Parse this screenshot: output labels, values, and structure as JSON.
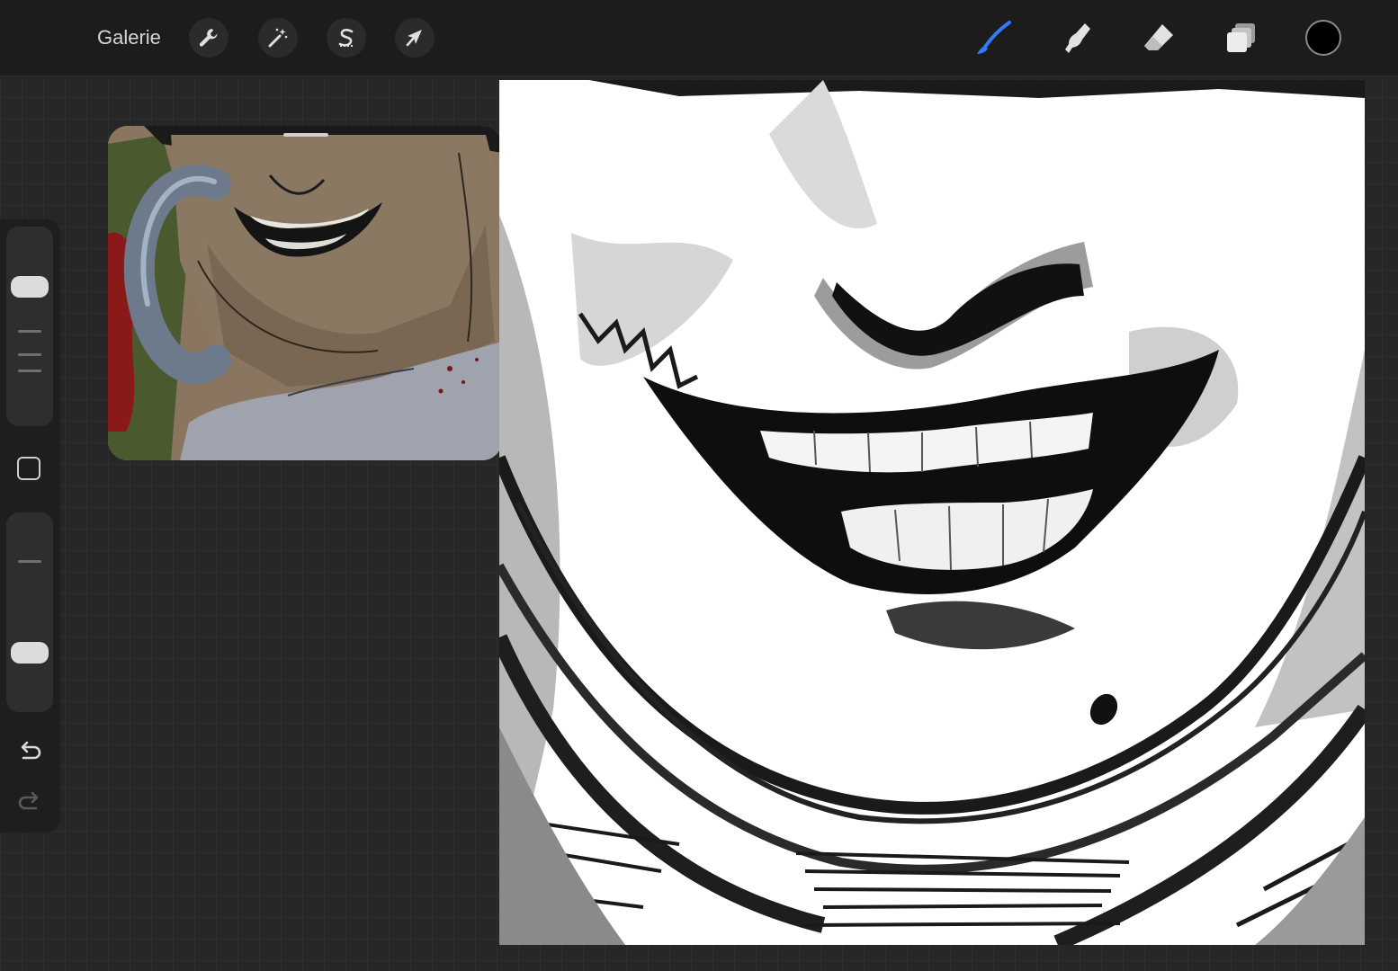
{
  "toolbar": {
    "gallery_label": "Galerie",
    "left_tools": [
      {
        "icon": "wrench-icon",
        "name": "actions"
      },
      {
        "icon": "magic-wand-icon",
        "name": "adjustments"
      },
      {
        "icon": "selection-s-icon",
        "name": "selection"
      },
      {
        "icon": "arrow-cursor-icon",
        "name": "transform"
      }
    ],
    "right_tools": [
      {
        "icon": "brush-icon",
        "name": "paint",
        "active": true
      },
      {
        "icon": "smudge-icon",
        "name": "smudge",
        "active": false
      },
      {
        "icon": "eraser-icon",
        "name": "eraser",
        "active": false
      },
      {
        "icon": "layers-icon",
        "name": "layers",
        "active": false
      }
    ],
    "current_color": "#000000",
    "accent_color": "#2f7df6"
  },
  "sidebar": {
    "brush_size_level": 0.75,
    "opacity_level": 0.25,
    "icons": [
      "modify-square-icon",
      "undo-icon",
      "redo-icon"
    ]
  },
  "reference_window": {
    "content": "color-reference-painting"
  },
  "canvas": {
    "content": "grayscale-smile-sketch",
    "background": "#ffffff"
  }
}
